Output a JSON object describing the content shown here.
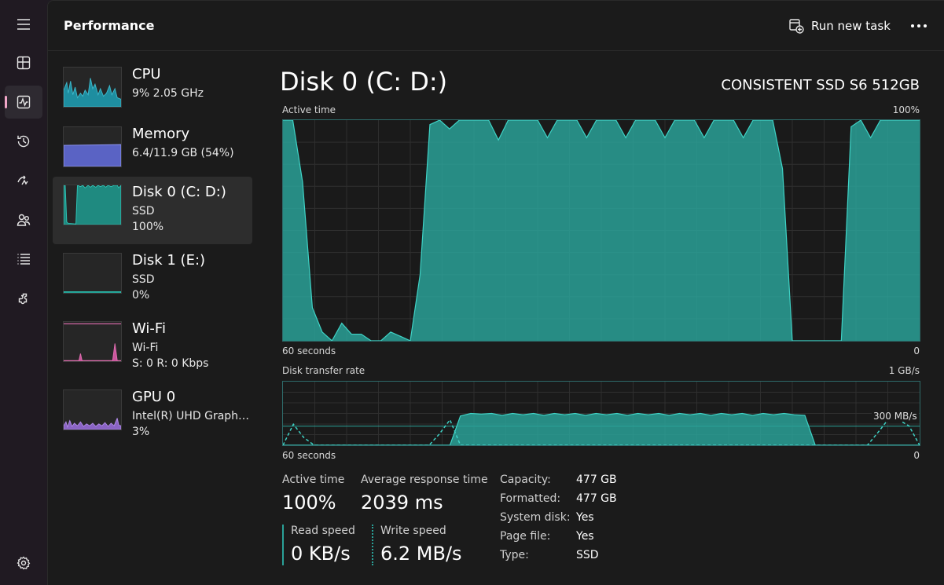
{
  "app": {
    "page_title": "Performance",
    "run_task_label": "Run new task",
    "accent": "#f1a6c8"
  },
  "nav_rail": [
    {
      "icon": "hamburger-menu-icon"
    },
    {
      "icon": "processes-icon"
    },
    {
      "icon": "performance-icon",
      "active": true
    },
    {
      "icon": "app-history-icon"
    },
    {
      "icon": "startup-apps-icon"
    },
    {
      "icon": "users-icon"
    },
    {
      "icon": "details-icon"
    },
    {
      "icon": "services-icon"
    },
    {
      "icon": "settings-icon"
    }
  ],
  "resources": [
    {
      "name": "CPU",
      "sub1": "9%  2.05 GHz",
      "sub2": "",
      "color": "#3cb7c9"
    },
    {
      "name": "Memory",
      "sub1": "6.4/11.9 GB (54%)",
      "sub2": "",
      "color": "#6a72d6"
    },
    {
      "name": "Disk 0 (C: D:)",
      "sub1": "SSD",
      "sub2": "100%",
      "color": "#2aa198",
      "selected": true
    },
    {
      "name": "Disk 1 (E:)",
      "sub1": "SSD",
      "sub2": "0%",
      "color": "#2aa198"
    },
    {
      "name": "Wi-Fi",
      "sub1": "Wi-Fi",
      "sub2": "S: 0 R: 0 Kbps",
      "color": "#e06db0"
    },
    {
      "name": "GPU 0",
      "sub1": "Intel(R) UHD Graphics",
      "sub2": "3%",
      "color": "#a07ad8"
    }
  ],
  "detail": {
    "title": "Disk 0 (C: D:)",
    "device": "CONSISTENT SSD S6 512GB",
    "graph_color": "#2aa198",
    "active_graph": {
      "label": "Active time",
      "max_label": "100%",
      "time_label": "60 seconds",
      "min_label": "0"
    },
    "rate_graph": {
      "label": "Disk transfer rate",
      "max_label": "1 GB/s",
      "marker_label": "300 MB/s",
      "time_label": "60 seconds",
      "min_label": "0"
    },
    "stats": {
      "active_time_label": "Active time",
      "active_time": "100%",
      "avg_response_label": "Average response time",
      "avg_response": "2039 ms",
      "read_label": "Read speed",
      "read": "0 KB/s",
      "write_label": "Write speed",
      "write": "6.2 MB/s"
    },
    "properties": [
      {
        "key": "Capacity:",
        "value": "477 GB"
      },
      {
        "key": "Formatted:",
        "value": "477 GB"
      },
      {
        "key": "System disk:",
        "value": "Yes"
      },
      {
        "key": "Page file:",
        "value": "Yes"
      },
      {
        "key": "Type:",
        "value": "SSD"
      }
    ]
  },
  "chart_data": [
    {
      "type": "area",
      "title": "Active time",
      "xlabel": "60 seconds",
      "ylabel": "",
      "ylim": [
        0,
        100
      ],
      "x": [
        60,
        59,
        58,
        57,
        56,
        55,
        54,
        53,
        52,
        51,
        50,
        49,
        48,
        47,
        46,
        45,
        44,
        43,
        42,
        41,
        40,
        39,
        38,
        37,
        36,
        35,
        34,
        33,
        32,
        31,
        30,
        29,
        28,
        27,
        26,
        25,
        24,
        23,
        22,
        21,
        20,
        19,
        18,
        17,
        16,
        15,
        14,
        13,
        12,
        11,
        10,
        9,
        8,
        7,
        6,
        5,
        4,
        3,
        2,
        1,
        0
      ],
      "series": [
        {
          "values": [
            100,
            100,
            72,
            15,
            4,
            0,
            8,
            3,
            3,
            0,
            0,
            4,
            2,
            0,
            30,
            98,
            100,
            96,
            100,
            100,
            100,
            100,
            91,
            100,
            100,
            100,
            100,
            92,
            100,
            100,
            100,
            92,
            100,
            100,
            100,
            92,
            100,
            100,
            100,
            92,
            100,
            100,
            100,
            92,
            100,
            100,
            100,
            92,
            100,
            100,
            100,
            78,
            0,
            0,
            0,
            0,
            0,
            0,
            97,
            100,
            92,
            100,
            100,
            100,
            100,
            100
          ]
        }
      ]
    },
    {
      "type": "line",
      "title": "Disk transfer rate",
      "xlabel": "60 seconds",
      "ylabel": "",
      "ylim": [
        0,
        1000
      ],
      "series": [
        {
          "values": [
            0,
            330,
            120,
            0,
            0,
            0,
            0,
            0,
            0,
            0,
            0,
            0,
            0,
            0,
            0,
            180,
            400,
            0,
            0,
            0,
            0,
            0,
            0,
            0,
            0,
            0,
            0,
            0,
            0,
            0,
            0,
            0,
            0,
            0,
            0,
            0,
            0,
            0,
            0,
            0,
            0,
            0,
            0,
            0,
            0,
            0,
            0,
            0,
            0,
            0,
            0,
            0,
            0,
            0,
            0,
            0,
            0,
            200,
            410,
            400,
            300,
            0
          ],
          "style": "dashed"
        },
        {
          "values": [
            0,
            0,
            0,
            0,
            0,
            0,
            0,
            0,
            0,
            0,
            0,
            0,
            0,
            0,
            0,
            0,
            0,
            460,
            500,
            490,
            500,
            470,
            500,
            480,
            500,
            470,
            500,
            480,
            500,
            470,
            500,
            480,
            500,
            470,
            500,
            480,
            500,
            470,
            500,
            480,
            500,
            470,
            500,
            480,
            500,
            470,
            500,
            480,
            500,
            480,
            470,
            0,
            0,
            0,
            0,
            0,
            0,
            0,
            0,
            0,
            0,
            0
          ],
          "style": "filled"
        }
      ]
    }
  ]
}
